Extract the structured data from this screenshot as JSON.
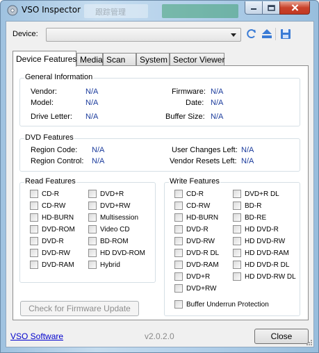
{
  "window": {
    "title": "VSO Inspector",
    "background_text": "跟踪管理",
    "controls": {
      "minimize_icon": "minimize-icon",
      "maximize_icon": "maximize-icon",
      "close_icon": "close-icon"
    }
  },
  "device": {
    "label": "Device:",
    "selected": "",
    "toolbar_icons": [
      "refresh-icon",
      "eject-icon",
      "save-icon"
    ]
  },
  "tabs": [
    {
      "label": "Device Features",
      "active": true
    },
    {
      "label": "Media",
      "active": false
    },
    {
      "label": "Scan",
      "active": false
    },
    {
      "label": "System",
      "active": false
    },
    {
      "label": "Sector Viewer",
      "active": false
    }
  ],
  "general": {
    "title": "General Information",
    "vendor_label": "Vendor:",
    "vendor_value": "N/A",
    "model_label": "Model:",
    "model_value": "N/A",
    "drive_letter_label": "Drive Letter:",
    "drive_letter_value": "N/A",
    "firmware_label": "Firmware:",
    "firmware_value": "N/A",
    "date_label": "Date:",
    "date_value": "N/A",
    "buffer_size_label": "Buffer Size:",
    "buffer_size_value": "N/A"
  },
  "dvd": {
    "title": "DVD Features",
    "region_code_label": "Region Code:",
    "region_code_value": "N/A",
    "region_control_label": "Region Control:",
    "region_control_value": "N/A",
    "user_changes_label": "User Changes Left:",
    "user_changes_value": "N/A",
    "vendor_resets_label": "Vendor Resets Left:",
    "vendor_resets_value": "N/A"
  },
  "read_features": {
    "title": "Read Features",
    "col1": [
      "CD-R",
      "CD-RW",
      "HD-BURN",
      "DVD-ROM",
      "DVD-R",
      "DVD-RW",
      "DVD-RAM"
    ],
    "col2": [
      "DVD+R",
      "DVD+RW",
      "Multisession",
      "Video CD",
      "BD-ROM",
      "HD DVD-ROM",
      "Hybrid"
    ]
  },
  "write_features": {
    "title": "Write Features",
    "col1": [
      "CD-R",
      "CD-RW",
      "HD-BURN",
      "DVD-R",
      "DVD-RW",
      "DVD-R DL",
      "DVD-RAM",
      "DVD+R",
      "DVD+RW"
    ],
    "col2": [
      "DVD+R DL",
      "BD-R",
      "BD-RE",
      "HD DVD-R",
      "HD DVD-RW",
      "HD DVD-RAM",
      "HD DVD-R DL",
      "HD DVD-RW DL"
    ],
    "buffer_underrun": "Buffer Underrun Protection"
  },
  "firmware_button": "Check for Firmware Update",
  "footer": {
    "link": "VSO Software",
    "version": "v2.0.2.0",
    "close_button": "Close"
  }
}
